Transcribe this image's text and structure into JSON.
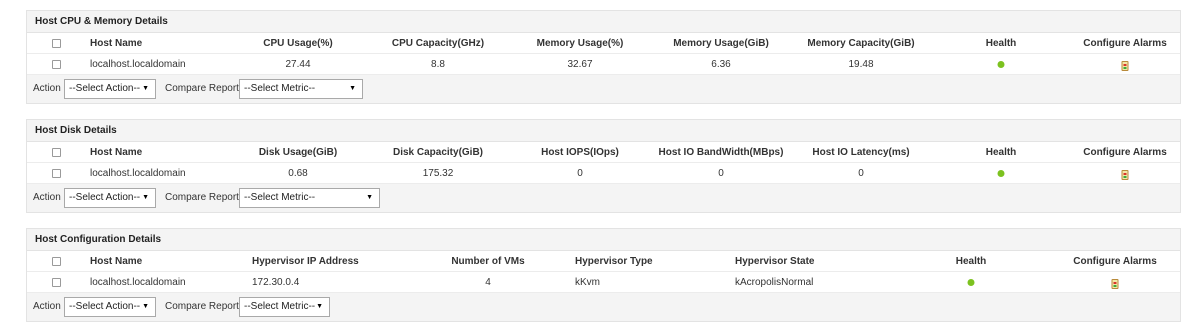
{
  "cpu_memory": {
    "title": "Host CPU & Memory Details",
    "headers": [
      "Host Name",
      "CPU Usage(%)",
      "CPU Capacity(GHz)",
      "Memory Usage(%)",
      "Memory Usage(GiB)",
      "Memory Capacity(GiB)",
      "Health",
      "Configure Alarms"
    ],
    "rows": [
      {
        "host": "localhost.localdomain",
        "cpu_usage": "27.44",
        "cpu_capacity": "8.8",
        "mem_usage_pct": "32.67",
        "mem_usage_gib": "6.36",
        "mem_capacity": "19.48",
        "health": "ok"
      }
    ],
    "action_label": "Action",
    "action_value": "--Select Action--",
    "compare_label": "Compare Reports",
    "metric_value": "--Select Metric--"
  },
  "disk": {
    "title": "Host Disk Details",
    "headers": [
      "Host Name",
      "Disk Usage(GiB)",
      "Disk Capacity(GiB)",
      "Host IOPS(IOps)",
      "Host IO BandWidth(MBps)",
      "Host IO Latency(ms)",
      "Health",
      "Configure Alarms"
    ],
    "rows": [
      {
        "host": "localhost.localdomain",
        "disk_usage": "0.68",
        "disk_capacity": "175.32",
        "iops": "0",
        "bandwidth": "0",
        "latency": "0",
        "health": "ok"
      }
    ],
    "action_label": "Action",
    "action_value": "--Select Action--",
    "compare_label": "Compare Reports",
    "metric_value": "--Select Metric--"
  },
  "config": {
    "title": "Host Configuration Details",
    "headers": [
      "Host Name",
      "Hypervisor IP Address",
      "Number of VMs",
      "Hypervisor Type",
      "Hypervisor State",
      "Health",
      "Configure Alarms"
    ],
    "rows": [
      {
        "host": "localhost.localdomain",
        "ip": "172.30.0.4",
        "vms": "4",
        "type": "kKvm",
        "state": "kAcropolisNormal",
        "health": "ok"
      }
    ],
    "action_label": "Action",
    "action_value": "--Select Action--",
    "compare_label": "Compare Reports",
    "metric_value": "--Select Metric--"
  },
  "colors": {
    "health_ok": "#7cc21f",
    "panel_bg": "#f4f4f4",
    "border": "#e3e3e3"
  }
}
